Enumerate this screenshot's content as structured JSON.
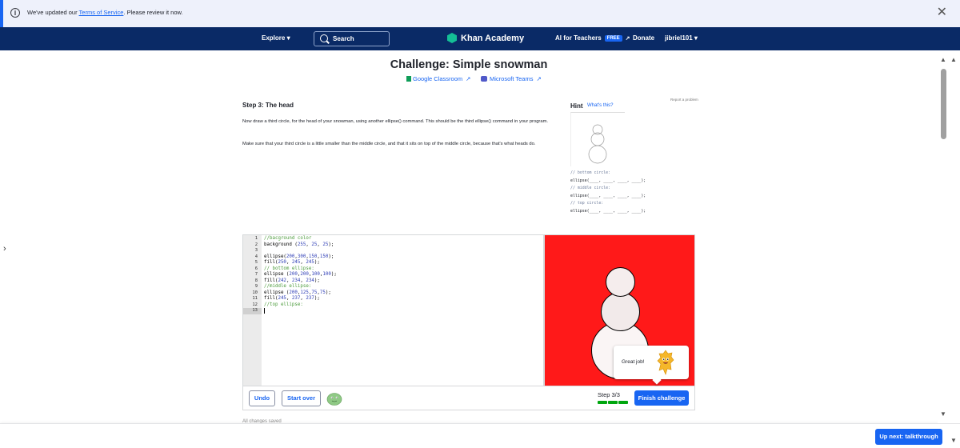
{
  "notice": {
    "prefix": "We've updated our ",
    "link": "Terms of Service",
    "suffix": ". Please review it now."
  },
  "nav": {
    "explore": "Explore",
    "search": "Search",
    "logo": "Khan Academy",
    "ai_teachers": "AI for Teachers",
    "free_badge": "FREE",
    "donate": "Donate",
    "user": "jibriel101"
  },
  "page": {
    "title": "Challenge: Simple snowman",
    "google_classroom": "Google Classroom",
    "microsoft_teams": "Microsoft Teams",
    "report": "Report a problem"
  },
  "step": {
    "title": "Step 3: The head",
    "para1": "Now draw a third circle, for the head of your snowman, using another ellipse() command. This should be the third ellipse() command in your program.",
    "para2": "Make sure that your third circle is a little smaller than the middle circle, and that it sits on top of the middle circle, because that's what heads do."
  },
  "hint": {
    "title": "Hint",
    "whats_this": "What's this?",
    "code": [
      {
        "text": "// bottom circle:",
        "comment": true
      },
      {
        "text": "ellipse(____, ____, ____, ____);",
        "comment": false
      },
      {
        "text": "// middle circle:",
        "comment": true
      },
      {
        "text": "ellipse(____, ____, ____, ____);",
        "comment": false
      },
      {
        "text": "// top circle:",
        "comment": true
      },
      {
        "text": "ellipse(____, ____, ____, ____);",
        "comment": false
      }
    ]
  },
  "editor": {
    "lines": [
      "//bacground color",
      "background (255, 25, 25);",
      "",
      "ellipse(200,300,150,150);",
      "fill(250, 245, 245);",
      "// bottom ellipse:",
      "ellipse (200,200,100,100);",
      "fill(242, 234, 234);",
      "//middle ellipse:",
      "ellipse (200,125,75,75);",
      "fill(245, 237, 237);",
      "//top ellipse:",
      ""
    ],
    "active_line": 13
  },
  "canvas": {
    "background": "#ff1919",
    "bubble_text": "Great job!"
  },
  "controls": {
    "undo": "Undo",
    "start_over": "Start over",
    "step_label": "Step 3/3",
    "progress_complete": 3,
    "progress_total": 3,
    "finish": "Finish challenge",
    "saved": "All changes saved"
  },
  "footer": {
    "next": "Up next: talkthrough"
  },
  "colors": {
    "accent": "#1865f2",
    "nav_bg": "#0a2a66",
    "success": "#00a60e",
    "brand_green": "#14bf96"
  }
}
